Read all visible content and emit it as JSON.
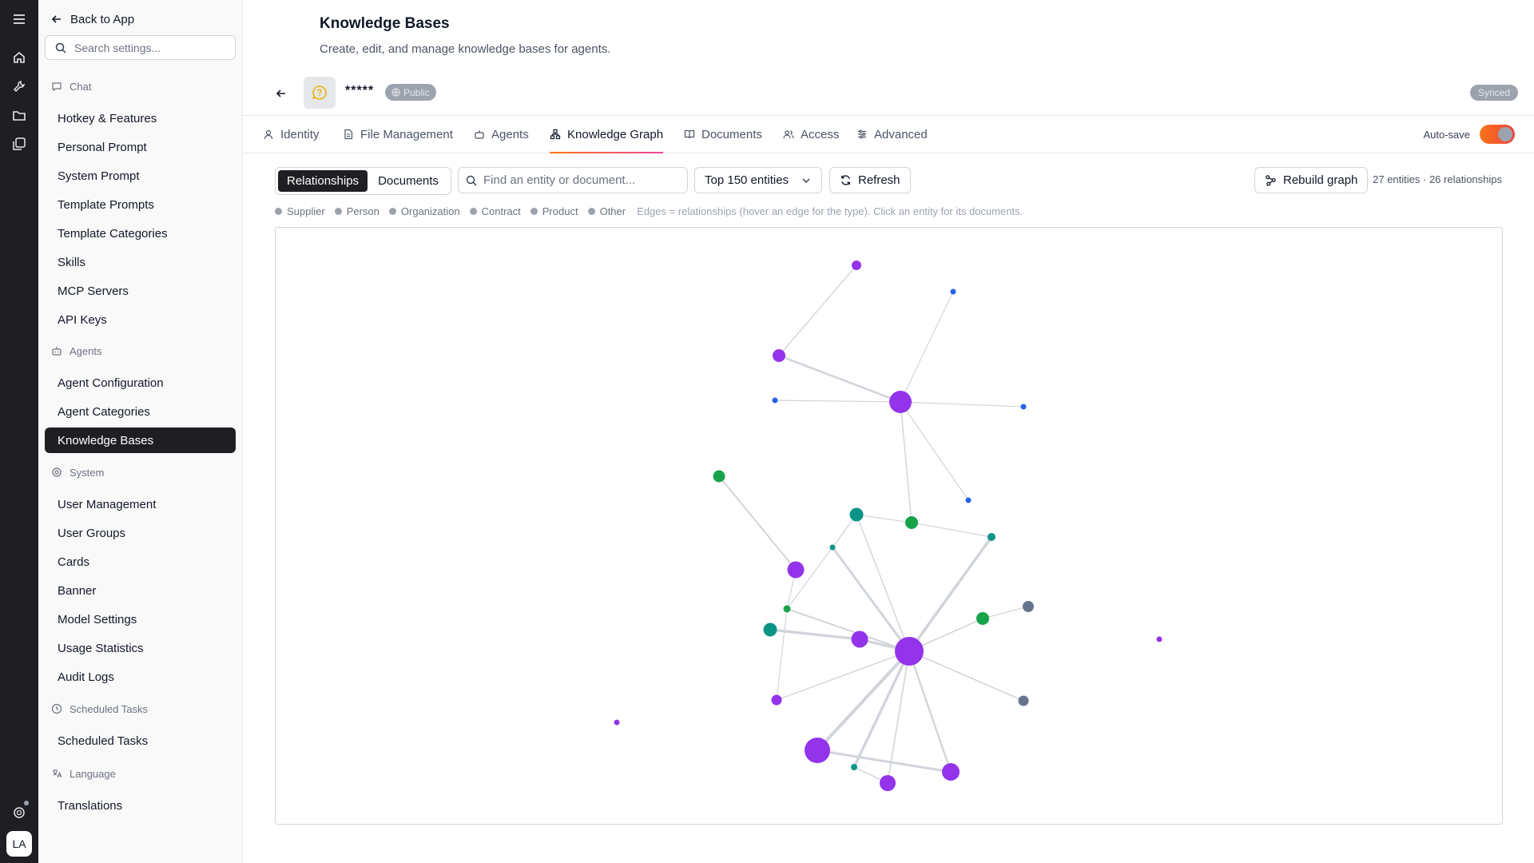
{
  "rail": {
    "avatar_initials": "LA",
    "icons": [
      "menu-icon",
      "home-icon",
      "wrench-icon",
      "folder-icon",
      "gallery-icon",
      "help-icon"
    ]
  },
  "sidebar": {
    "back_label": "Back to App",
    "search_placeholder": "Search settings...",
    "sections": [
      {
        "title": "Chat",
        "icon": "chat-icon",
        "items": [
          "Hotkey & Features",
          "Personal Prompt",
          "System Prompt",
          "Template Prompts",
          "Template Categories",
          "Skills",
          "MCP Servers",
          "API Keys"
        ]
      },
      {
        "title": "Agents",
        "icon": "robot-icon",
        "items": [
          "Agent Configuration",
          "Agent Categories",
          "Knowledge Bases"
        ]
      },
      {
        "title": "System",
        "icon": "settings-icon",
        "items": [
          "User Management",
          "User Groups",
          "Cards",
          "Banner",
          "Model Settings",
          "Usage Statistics",
          "Audit Logs"
        ]
      },
      {
        "title": "Scheduled Tasks",
        "icon": "clock-icon",
        "items": [
          "Scheduled Tasks"
        ]
      },
      {
        "title": "Language",
        "icon": "translate-icon",
        "items": [
          "Translations"
        ]
      }
    ],
    "active_item": "Knowledge Bases"
  },
  "header": {
    "title": "Knowledge Bases",
    "subtitle": "Create, edit, and manage knowledge bases for agents."
  },
  "kb": {
    "name": "*****",
    "visibility": "Public",
    "status": "Synced"
  },
  "tabs": [
    {
      "label": "Identity",
      "icon": "user-icon"
    },
    {
      "label": "File Management",
      "icon": "file-icon"
    },
    {
      "label": "Agents",
      "icon": "robot-icon"
    },
    {
      "label": "Knowledge Graph",
      "icon": "graph-icon",
      "active": true
    },
    {
      "label": "Documents",
      "icon": "book-icon"
    },
    {
      "label": "Access",
      "icon": "users-icon"
    },
    {
      "label": "Advanced",
      "icon": "sliders-icon"
    }
  ],
  "autosave": {
    "label": "Auto-save",
    "enabled": true
  },
  "toolbar": {
    "view_options": [
      "Relationships",
      "Documents"
    ],
    "active_view": "Relationships",
    "search_placeholder": "Find an entity or document...",
    "limit_selected": "Top 150 entities",
    "refresh_label": "Refresh",
    "rebuild_label": "Rebuild graph",
    "counts": "27 entities · 26 relationships"
  },
  "legend": {
    "types": [
      "Supplier",
      "Person",
      "Organization",
      "Contract",
      "Product",
      "Other"
    ],
    "hint": "Edges = relationships (hover an edge for the type). Click an entity for its documents."
  },
  "colors": {
    "purple": "#9333ea",
    "blue": "#2563eb",
    "green": "#16a34a",
    "teal": "#0d9488",
    "gray": "#64748b",
    "edge": "#d1d5db",
    "accent_start": "#f97316",
    "accent_end": "#ec4899"
  }
}
